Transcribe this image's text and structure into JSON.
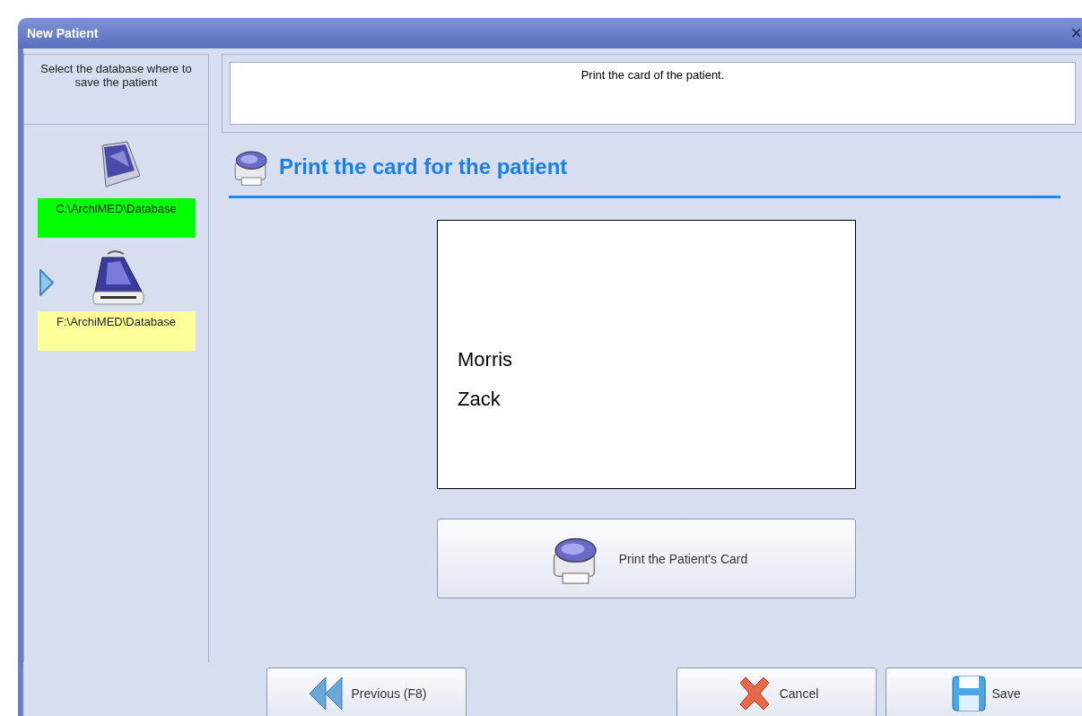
{
  "window": {
    "title": "New Patient",
    "close": "×"
  },
  "sidebar": {
    "heading": "Select the database where to save the patient",
    "databases": [
      {
        "path": "C:\\ArchiMED\\Database",
        "color": "#00ff00",
        "selected": false,
        "kind": "disk"
      },
      {
        "path": "F:\\ArchiMED\\Database",
        "color": "#ffff99",
        "selected": true,
        "kind": "drive"
      }
    ]
  },
  "message": "Print the card of the patient.",
  "section_title": "Print the card for the patient",
  "card": {
    "lines": [
      "Morris",
      "Zack"
    ]
  },
  "print_button": "Print the Patient's Card",
  "buttons": [
    {
      "label": "Previous (F8)",
      "kind": "previous"
    },
    {
      "label": "Cancel",
      "kind": "cancel"
    },
    {
      "label": "Save",
      "kind": "save"
    }
  ]
}
